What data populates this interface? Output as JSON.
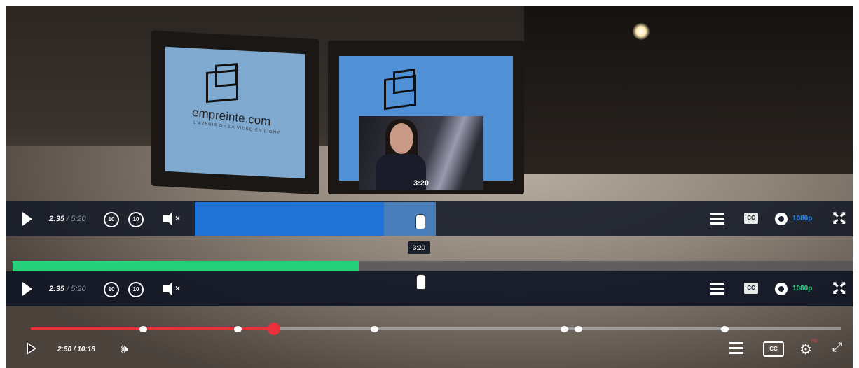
{
  "scene": {
    "brand_text": "empreinte.com",
    "brand_sub": "L'AVENIR DE LA VIDÉO EN LIGNE"
  },
  "preview": {
    "time": "3:20"
  },
  "player_blue": {
    "current_time": "2:35",
    "duration": "5:20",
    "time_separator": "/",
    "rewind_label": "10",
    "forward_label": "10",
    "mute_symbol": "×",
    "cc_label": "CC",
    "quality": "1080p",
    "progress_fraction": 0.2,
    "accent_color": "#1f72d6"
  },
  "player_green": {
    "current_time": "2:35",
    "duration": "5:20",
    "time_separator": "/",
    "rewind_label": "10",
    "forward_label": "10",
    "mute_symbol": "×",
    "cc_label": "CC",
    "quality": "1080p",
    "hover_time": "3:20",
    "progress_fraction": 0.41,
    "accent_color": "#24d07a"
  },
  "player_red": {
    "time_display": "2:50 / 10:18",
    "cc_label": "CC",
    "hd_badge": "HD",
    "progress_fraction": 0.3,
    "accent_color": "#e8313a"
  }
}
